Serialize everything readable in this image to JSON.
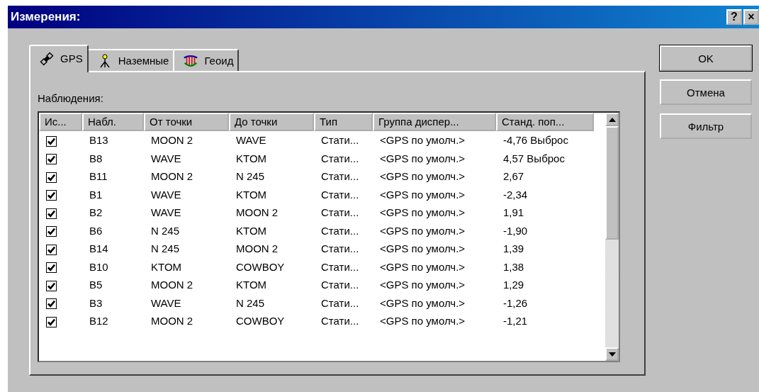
{
  "window": {
    "title": "Измерения:",
    "help_button": "?",
    "close_button": "×"
  },
  "tabs": [
    {
      "label": "GPS",
      "kind": "satellite",
      "selected": true
    },
    {
      "label": "Наземные",
      "kind": "tripod",
      "selected": false
    },
    {
      "label": "Геоид",
      "kind": "geoid",
      "selected": false
    }
  ],
  "observations_label": "Наблюдения:",
  "table": {
    "columns": [
      "Ис...",
      "Набл.",
      "От точки",
      "До точки",
      "Тип",
      "Группа диспер...",
      "Станд. поп..."
    ],
    "rows": [
      {
        "checked": true,
        "cells": [
          "",
          "B13",
          "MOON 2",
          "WAVE",
          "Стати...",
          "<GPS по умолч.>",
          "-4,76 Выброс"
        ]
      },
      {
        "checked": true,
        "cells": [
          "",
          "B8",
          "WAVE",
          "KTOM",
          "Стати...",
          "<GPS по умолч.>",
          "4,57 Выброс"
        ]
      },
      {
        "checked": true,
        "cells": [
          "",
          "B11",
          "MOON 2",
          "N 245",
          "Стати...",
          "<GPS по умолч.>",
          "2,67"
        ]
      },
      {
        "checked": true,
        "cells": [
          "",
          "B1",
          "WAVE",
          "KTOM",
          "Стати...",
          "<GPS по умолч.>",
          "-2,34"
        ]
      },
      {
        "checked": true,
        "cells": [
          "",
          "B2",
          "WAVE",
          "MOON 2",
          "Стати...",
          "<GPS по умолч.>",
          "1,91"
        ]
      },
      {
        "checked": true,
        "cells": [
          "",
          "B6",
          "N 245",
          "KTOM",
          "Стати...",
          "<GPS по умолч.>",
          "-1,90"
        ]
      },
      {
        "checked": true,
        "cells": [
          "",
          "B14",
          "N 245",
          "MOON 2",
          "Стати...",
          "<GPS по умолч.>",
          "1,39"
        ]
      },
      {
        "checked": true,
        "cells": [
          "",
          "B10",
          "KTOM",
          "COWBOY",
          "Стати...",
          "<GPS по умолч.>",
          "1,38"
        ]
      },
      {
        "checked": true,
        "cells": [
          "",
          "B5",
          "MOON 2",
          "KTOM",
          "Стати...",
          "<GPS по умолч.>",
          "1,29"
        ]
      },
      {
        "checked": true,
        "cells": [
          "",
          "B3",
          "WAVE",
          "N 245",
          "Стати...",
          "<GPS по умолч.>",
          "-1,26"
        ]
      },
      {
        "checked": true,
        "cells": [
          "",
          "B12",
          "MOON 2",
          "COWBOY",
          "Стати...",
          "<GPS по умолч.>",
          "-1,21"
        ]
      }
    ]
  },
  "buttons": [
    {
      "label": "OK",
      "default": true
    },
    {
      "label": "Отмена",
      "default": false
    },
    {
      "label": "Фильтр",
      "default": false
    }
  ]
}
